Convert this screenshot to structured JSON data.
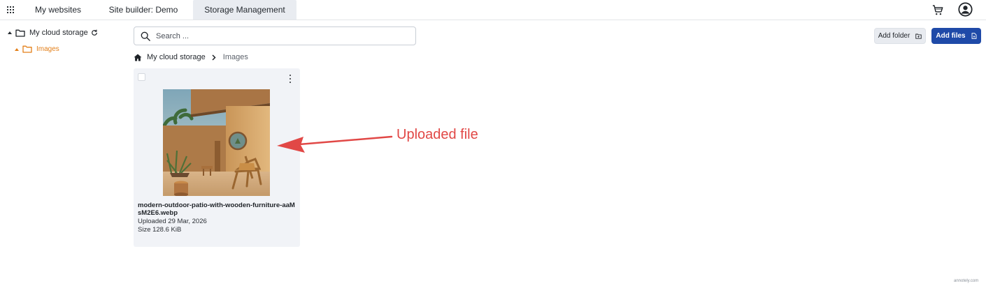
{
  "topbar": {
    "tabs": [
      {
        "label": "My websites"
      },
      {
        "label": "Site builder: Demo"
      },
      {
        "label": "Storage Management"
      }
    ]
  },
  "sidebar": {
    "root_label": "My cloud storage",
    "children": [
      {
        "label": "Images"
      }
    ]
  },
  "search": {
    "placeholder": "Search ..."
  },
  "toolbar": {
    "add_folder_label": "Add folder",
    "add_files_label": "Add files"
  },
  "breadcrumb": {
    "items": [
      "My cloud storage",
      "Images"
    ]
  },
  "file": {
    "name": "modern-outdoor-patio-with-wooden-furniture-aaMsM2E6.webp",
    "uploaded": "Uploaded 29 Mar, 2026",
    "size": "Size 128.6 KiB"
  },
  "annotation": {
    "label": "Uploaded file"
  },
  "watermark": {
    "text": "annotely.com"
  },
  "colors": {
    "accent": "#1f4aa8",
    "folder": "#e37f19",
    "annotation": "#e14846"
  },
  "icons": {
    "apps": "apps-grid-icon",
    "cart": "cart-icon",
    "user": "user-icon",
    "folder": "folder-icon",
    "refresh": "refresh-icon",
    "search": "search-icon",
    "home": "home-icon",
    "chevron": "chevron-right-icon",
    "more": "more-vertical-icon"
  }
}
